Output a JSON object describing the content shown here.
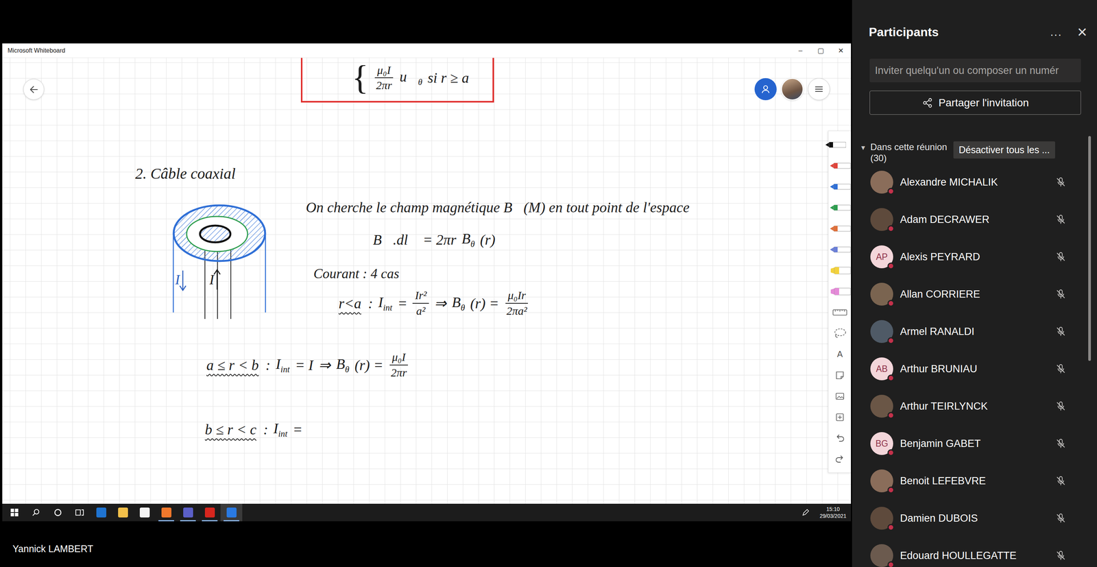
{
  "window": {
    "title": "Microsoft Whiteboard",
    "controls": [
      "–",
      "▢",
      "✕"
    ]
  },
  "canvas": {
    "result": {
      "tokens": [
        {
          "kind": "brace",
          "text": "{"
        },
        {
          "kind": "frac",
          "num": "μ₀I",
          "den": "2πr"
        },
        {
          "kind": "sub",
          "base": "u⃗",
          "sub": "θ"
        },
        {
          "kind": "text",
          "text": "si r ≥ a"
        }
      ]
    },
    "heading": "2. Câble coaxial",
    "intro": "On cherche le champ magnétique B⃗(M) en tout point de l'espace",
    "circulation": {
      "tokens": [
        {
          "kind": "text",
          "text": "∮ B⃗.dl⃗ = 2πr"
        },
        {
          "kind": "sub",
          "base": "B",
          "sub": "θ"
        },
        {
          "kind": "text",
          "text": "(r)"
        }
      ]
    },
    "courant": "Courant : 4 cas",
    "cases": [
      {
        "label": "r<a",
        "tokens": [
          {
            "kind": "text",
            "text": ":"
          },
          {
            "kind": "sub",
            "base": "I",
            "sub": "int"
          },
          {
            "kind": "text",
            "text": "="
          },
          {
            "kind": "frac",
            "num": "Ir²",
            "den": "a²"
          },
          {
            "kind": "text",
            "text": "⇒"
          },
          {
            "kind": "sub",
            "base": "B",
            "sub": "θ"
          },
          {
            "kind": "text",
            "text": "(r) ="
          },
          {
            "kind": "frac",
            "num": "μ₀Ir",
            "den": "2πa²"
          }
        ]
      },
      {
        "label": "a ≤ r < b",
        "tokens": [
          {
            "kind": "text",
            "text": ":"
          },
          {
            "kind": "sub",
            "base": "I",
            "sub": "int"
          },
          {
            "kind": "text",
            "text": "= I"
          },
          {
            "kind": "text",
            "text": "⇒"
          },
          {
            "kind": "sub",
            "base": "B",
            "sub": "θ"
          },
          {
            "kind": "text",
            "text": "(r) ="
          },
          {
            "kind": "frac",
            "num": "μ₀I",
            "den": "2πr"
          }
        ]
      },
      {
        "label": "b ≤ r < c",
        "tokens": [
          {
            "kind": "text",
            "text": ":"
          },
          {
            "kind": "sub",
            "base": "I",
            "sub": "int"
          },
          {
            "kind": "text",
            "text": "="
          }
        ]
      }
    ],
    "cable": {
      "labels": [
        {
          "text": "I",
          "color": "#2b5fc0",
          "direction": "down"
        },
        {
          "text": "I",
          "color": "#1a1a1a",
          "direction": "up"
        }
      ]
    },
    "tools": [
      {
        "kind": "pen",
        "color": "#111111",
        "selected": true
      },
      {
        "kind": "pen",
        "color": "#e0443a",
        "selected": false
      },
      {
        "kind": "pen",
        "color": "#2f6fd6",
        "selected": false
      },
      {
        "kind": "pen",
        "color": "#2e9e4f",
        "selected": false
      },
      {
        "kind": "pen",
        "color": "#e0703a",
        "selected": false
      },
      {
        "kind": "pen",
        "color": "#6a7fd8",
        "selected": false
      },
      {
        "kind": "highlighter",
        "color": "#f3d23c",
        "selected": false
      },
      {
        "kind": "highlighter",
        "color": "#e58ad8",
        "selected": false
      },
      {
        "kind": "ruler",
        "selected": false
      },
      {
        "kind": "lasso",
        "selected": false
      },
      {
        "kind": "text",
        "label": "A",
        "selected": false
      },
      {
        "kind": "note",
        "selected": false
      },
      {
        "kind": "image",
        "selected": false
      },
      {
        "kind": "insert",
        "selected": false
      },
      {
        "kind": "undo",
        "selected": false
      },
      {
        "kind": "redo",
        "selected": false
      }
    ]
  },
  "taskbar": {
    "apps": [
      {
        "color": "#1f74d1",
        "running": false,
        "selected": false
      },
      {
        "color": "#f2c04a",
        "running": false,
        "selected": false
      },
      {
        "color": "#f4f4f4",
        "running": false,
        "selected": false
      },
      {
        "color": "#f0782c",
        "running": true,
        "selected": false
      },
      {
        "color": "#5b5fc7",
        "running": true,
        "selected": false
      },
      {
        "color": "#d7261e",
        "running": true,
        "selected": false
      },
      {
        "color": "#2a7ae2",
        "running": true,
        "selected": true
      }
    ],
    "time": "15:10",
    "date": "29/03/2021"
  },
  "presenter": "Yannick LAMBERT",
  "panel": {
    "title": "Participants",
    "more": "...",
    "close": "×",
    "search": {
      "placeholder": "Inviter quelqu'un ou composer un numér"
    },
    "share": "Partager l'invitation",
    "section": {
      "title": "Dans cette réunion",
      "count": "(30)",
      "expanded": true,
      "caret": "▾"
    },
    "mute_all": "Désactiver tous les ...",
    "participants": [
      {
        "name": "Alexandre MICHALIK",
        "kind": "photo",
        "muted": true
      },
      {
        "name": "Adam DECRAWER",
        "kind": "photo",
        "muted": true
      },
      {
        "name": "Alexis PEYRARD",
        "kind": "initials",
        "initials": "AP",
        "muted": true
      },
      {
        "name": "Allan CORRIERE",
        "kind": "photo",
        "muted": true
      },
      {
        "name": "Armel RANALDI",
        "kind": "photo",
        "muted": true
      },
      {
        "name": "Arthur BRUNIAU",
        "kind": "initials",
        "initials": "AB",
        "muted": true
      },
      {
        "name": "Arthur TEIRLYNCK",
        "kind": "photo",
        "muted": true
      },
      {
        "name": "Benjamin GABET",
        "kind": "initials",
        "initials": "BG",
        "muted": true
      },
      {
        "name": "Benoit LEFEBVRE",
        "kind": "photo",
        "muted": true
      },
      {
        "name": "Damien DUBOIS",
        "kind": "photo",
        "muted": true
      },
      {
        "name": "Edouard HOULLEGATTE",
        "kind": "photo",
        "muted": true
      }
    ]
  }
}
